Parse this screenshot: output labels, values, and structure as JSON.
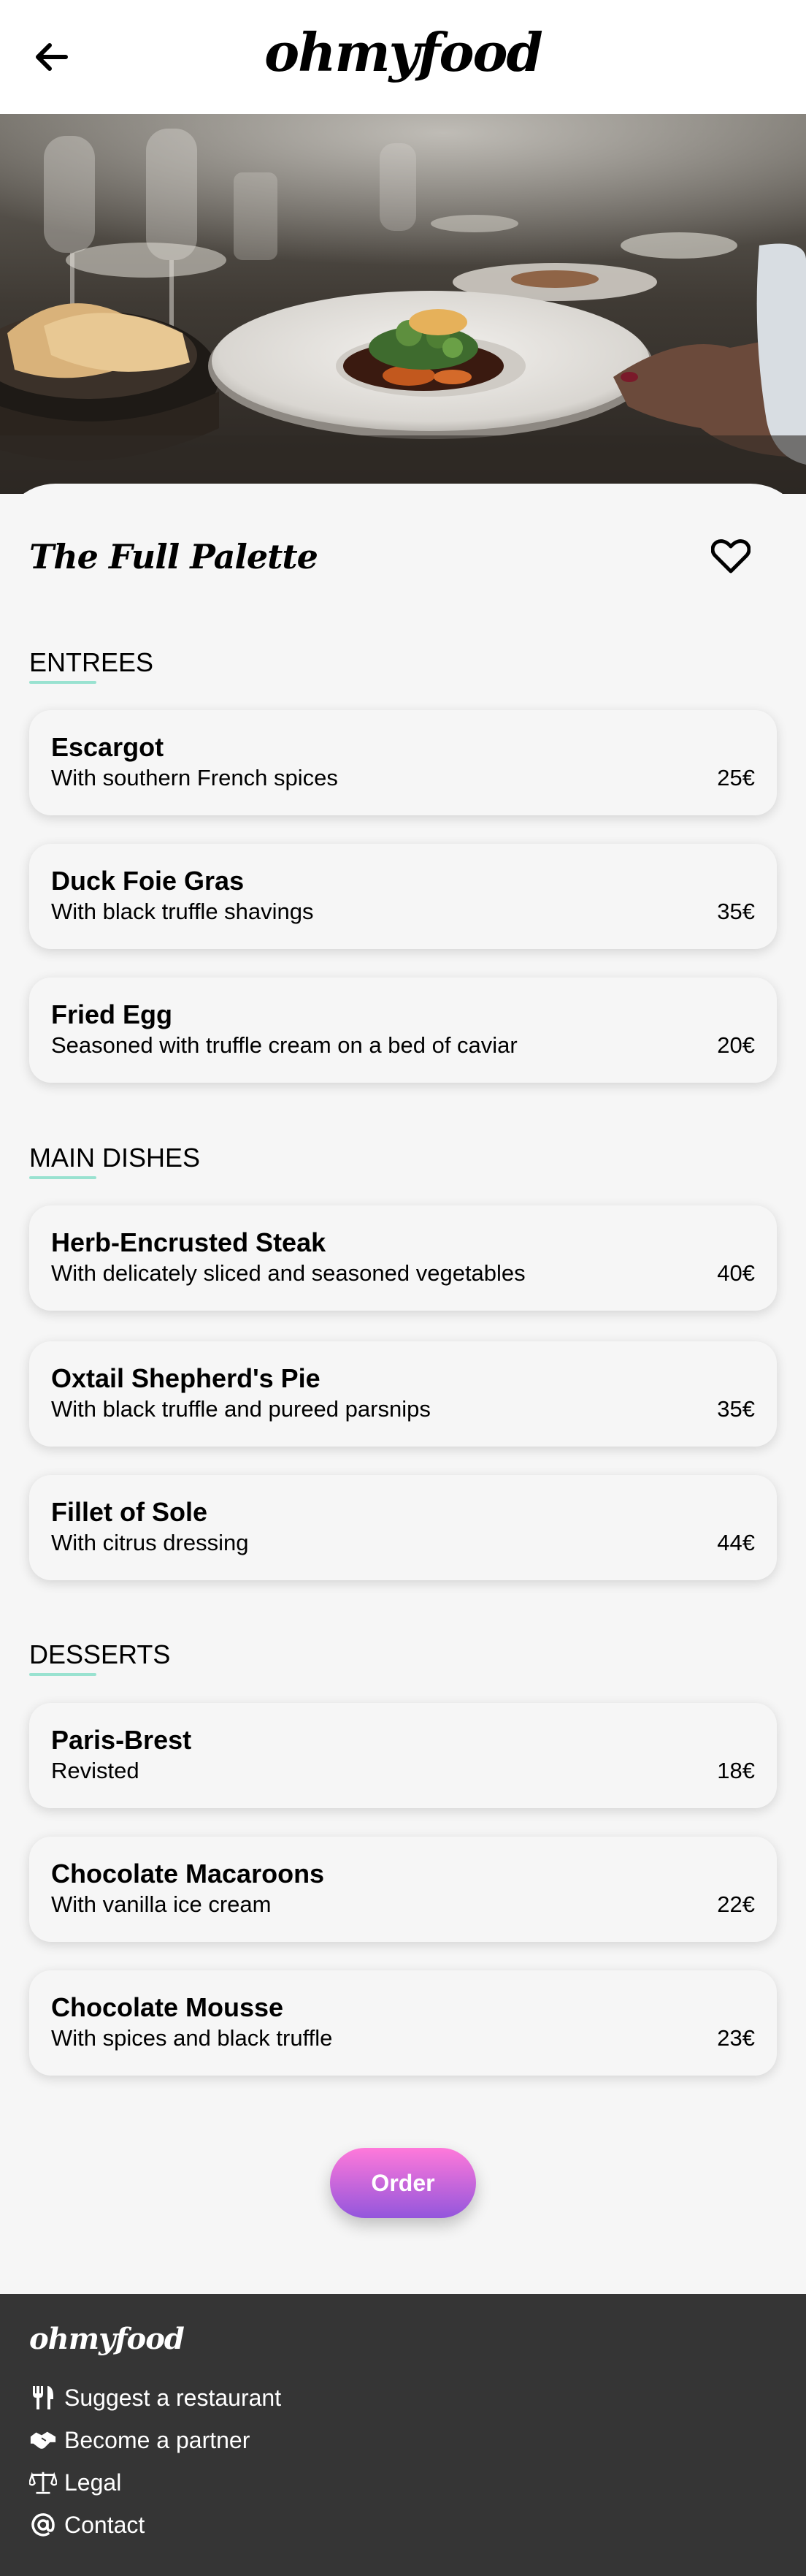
{
  "header": {
    "brand": "ohmyfood",
    "back_icon": "arrow-left-icon"
  },
  "restaurant": {
    "name": "The Full Palette",
    "favorite_icon": "heart-outline-icon"
  },
  "sections": [
    {
      "title": "ENTREES",
      "items": [
        {
          "name": "Escargot",
          "description": "With southern French spices",
          "price": "25€"
        },
        {
          "name": "Duck Foie Gras",
          "description": "With black truffle shavings",
          "price": "35€"
        },
        {
          "name": "Fried Egg",
          "description": "Seasoned with truffle cream on a bed of caviar",
          "price": "20€"
        }
      ]
    },
    {
      "title": "MAIN DISHES",
      "items": [
        {
          "name": "Herb-Encrusted Steak",
          "description": "With delicately sliced and seasoned vegetables",
          "price": "40€"
        },
        {
          "name": "Oxtail Shepherd's Pie",
          "description": "With black truffle and pureed parsnips",
          "price": "35€"
        },
        {
          "name": "Fillet of Sole",
          "description": "With citrus dressing",
          "price": "44€"
        }
      ]
    },
    {
      "title": "DESSERTS",
      "items": [
        {
          "name": "Paris-Brest",
          "description": "Revisted",
          "price": "18€"
        },
        {
          "name": "Chocolate Macaroons",
          "description": "With vanilla ice cream",
          "price": "22€"
        },
        {
          "name": "Chocolate Mousse",
          "description": "With spices and black truffle",
          "price": "23€"
        }
      ]
    }
  ],
  "order_button": {
    "label": "Order"
  },
  "footer": {
    "brand": "ohmyfood",
    "links": [
      {
        "label": "Suggest a restaurant",
        "icon": "utensils-icon"
      },
      {
        "label": "Become a partner",
        "icon": "handshake-icon"
      },
      {
        "label": "Legal",
        "icon": "scale-icon"
      },
      {
        "label": "Contact",
        "icon": "at-sign-icon"
      }
    ]
  },
  "colors": {
    "accent_underline": "#99e2d0",
    "order_gradient_top": "#ff79da",
    "order_gradient_bottom": "#9356dc",
    "footer_bg": "#353535",
    "page_bg": "#f6f6f6"
  }
}
